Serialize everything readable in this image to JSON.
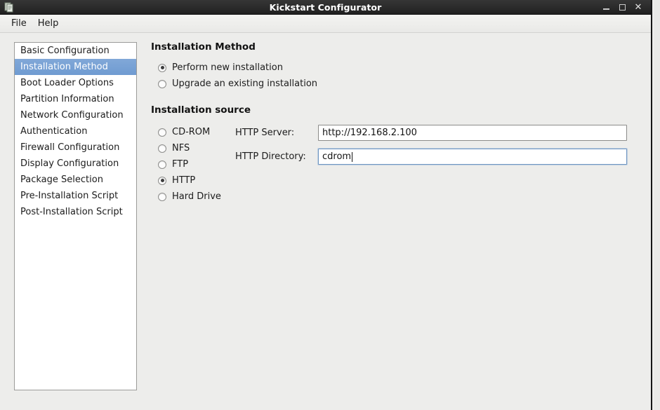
{
  "window": {
    "title": "Kickstart Configurator",
    "icon": "app-icon",
    "buttons": {
      "minimize": "minimize-icon",
      "maximize": "maximize-icon",
      "close": "close-icon"
    }
  },
  "menubar": {
    "items": [
      {
        "label": "File"
      },
      {
        "label": "Help"
      }
    ]
  },
  "sidebar": {
    "selected_index": 1,
    "items": [
      {
        "label": "Basic Configuration"
      },
      {
        "label": "Installation Method"
      },
      {
        "label": "Boot Loader Options"
      },
      {
        "label": "Partition Information"
      },
      {
        "label": "Network Configuration"
      },
      {
        "label": "Authentication"
      },
      {
        "label": "Firewall Configuration"
      },
      {
        "label": "Display Configuration"
      },
      {
        "label": "Package Selection"
      },
      {
        "label": "Pre-Installation Script"
      },
      {
        "label": "Post-Installation Script"
      }
    ]
  },
  "main": {
    "method_section": {
      "title": "Installation Method",
      "options": [
        {
          "label": "Perform new installation",
          "checked": true
        },
        {
          "label": "Upgrade an existing installation",
          "checked": false
        }
      ]
    },
    "source_section": {
      "title": "Installation source",
      "options": [
        {
          "label": "CD-ROM",
          "checked": false
        },
        {
          "label": "NFS",
          "checked": false
        },
        {
          "label": "FTP",
          "checked": false
        },
        {
          "label": "HTTP",
          "checked": true
        },
        {
          "label": "Hard Drive",
          "checked": false
        }
      ],
      "fields": [
        {
          "label": "HTTP Server:",
          "value": "http://192.168.2.100",
          "placeholder": "",
          "focused": false
        },
        {
          "label": "HTTP Directory:",
          "value": "cdrom",
          "placeholder": "",
          "focused": true
        }
      ]
    }
  },
  "colors": {
    "titlebar": "#2b2b2b",
    "selection": "#759fd4",
    "window_bg": "#ededeb",
    "field_border": "#8b8b89",
    "focus_border": "#6f96c2"
  }
}
